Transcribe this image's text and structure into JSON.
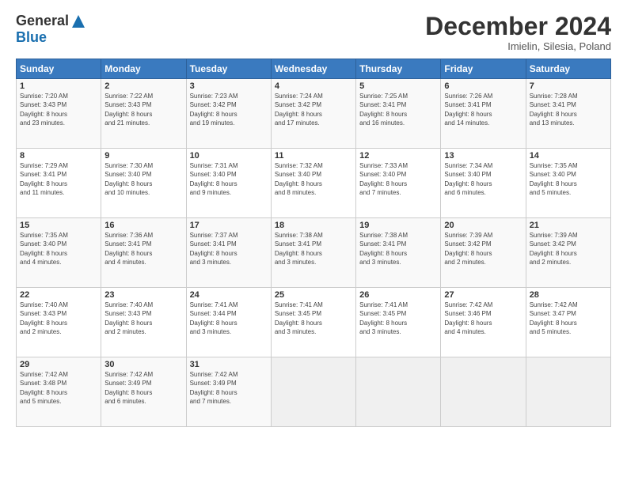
{
  "header": {
    "logo_general": "General",
    "logo_blue": "Blue",
    "month_title": "December 2024",
    "location": "Imielin, Silesia, Poland"
  },
  "calendar": {
    "days_of_week": [
      "Sunday",
      "Monday",
      "Tuesday",
      "Wednesday",
      "Thursday",
      "Friday",
      "Saturday"
    ],
    "weeks": [
      [
        {
          "day": "1",
          "info": "Sunrise: 7:20 AM\nSunset: 3:43 PM\nDaylight: 8 hours\nand 23 minutes."
        },
        {
          "day": "2",
          "info": "Sunrise: 7:22 AM\nSunset: 3:43 PM\nDaylight: 8 hours\nand 21 minutes."
        },
        {
          "day": "3",
          "info": "Sunrise: 7:23 AM\nSunset: 3:42 PM\nDaylight: 8 hours\nand 19 minutes."
        },
        {
          "day": "4",
          "info": "Sunrise: 7:24 AM\nSunset: 3:42 PM\nDaylight: 8 hours\nand 17 minutes."
        },
        {
          "day": "5",
          "info": "Sunrise: 7:25 AM\nSunset: 3:41 PM\nDaylight: 8 hours\nand 16 minutes."
        },
        {
          "day": "6",
          "info": "Sunrise: 7:26 AM\nSunset: 3:41 PM\nDaylight: 8 hours\nand 14 minutes."
        },
        {
          "day": "7",
          "info": "Sunrise: 7:28 AM\nSunset: 3:41 PM\nDaylight: 8 hours\nand 13 minutes."
        }
      ],
      [
        {
          "day": "8",
          "info": "Sunrise: 7:29 AM\nSunset: 3:41 PM\nDaylight: 8 hours\nand 11 minutes."
        },
        {
          "day": "9",
          "info": "Sunrise: 7:30 AM\nSunset: 3:40 PM\nDaylight: 8 hours\nand 10 minutes."
        },
        {
          "day": "10",
          "info": "Sunrise: 7:31 AM\nSunset: 3:40 PM\nDaylight: 8 hours\nand 9 minutes."
        },
        {
          "day": "11",
          "info": "Sunrise: 7:32 AM\nSunset: 3:40 PM\nDaylight: 8 hours\nand 8 minutes."
        },
        {
          "day": "12",
          "info": "Sunrise: 7:33 AM\nSunset: 3:40 PM\nDaylight: 8 hours\nand 7 minutes."
        },
        {
          "day": "13",
          "info": "Sunrise: 7:34 AM\nSunset: 3:40 PM\nDaylight: 8 hours\nand 6 minutes."
        },
        {
          "day": "14",
          "info": "Sunrise: 7:35 AM\nSunset: 3:40 PM\nDaylight: 8 hours\nand 5 minutes."
        }
      ],
      [
        {
          "day": "15",
          "info": "Sunrise: 7:35 AM\nSunset: 3:40 PM\nDaylight: 8 hours\nand 4 minutes."
        },
        {
          "day": "16",
          "info": "Sunrise: 7:36 AM\nSunset: 3:41 PM\nDaylight: 8 hours\nand 4 minutes."
        },
        {
          "day": "17",
          "info": "Sunrise: 7:37 AM\nSunset: 3:41 PM\nDaylight: 8 hours\nand 3 minutes."
        },
        {
          "day": "18",
          "info": "Sunrise: 7:38 AM\nSunset: 3:41 PM\nDaylight: 8 hours\nand 3 minutes."
        },
        {
          "day": "19",
          "info": "Sunrise: 7:38 AM\nSunset: 3:41 PM\nDaylight: 8 hours\nand 3 minutes."
        },
        {
          "day": "20",
          "info": "Sunrise: 7:39 AM\nSunset: 3:42 PM\nDaylight: 8 hours\nand 2 minutes."
        },
        {
          "day": "21",
          "info": "Sunrise: 7:39 AM\nSunset: 3:42 PM\nDaylight: 8 hours\nand 2 minutes."
        }
      ],
      [
        {
          "day": "22",
          "info": "Sunrise: 7:40 AM\nSunset: 3:43 PM\nDaylight: 8 hours\nand 2 minutes."
        },
        {
          "day": "23",
          "info": "Sunrise: 7:40 AM\nSunset: 3:43 PM\nDaylight: 8 hours\nand 2 minutes."
        },
        {
          "day": "24",
          "info": "Sunrise: 7:41 AM\nSunset: 3:44 PM\nDaylight: 8 hours\nand 3 minutes."
        },
        {
          "day": "25",
          "info": "Sunrise: 7:41 AM\nSunset: 3:45 PM\nDaylight: 8 hours\nand 3 minutes."
        },
        {
          "day": "26",
          "info": "Sunrise: 7:41 AM\nSunset: 3:45 PM\nDaylight: 8 hours\nand 3 minutes."
        },
        {
          "day": "27",
          "info": "Sunrise: 7:42 AM\nSunset: 3:46 PM\nDaylight: 8 hours\nand 4 minutes."
        },
        {
          "day": "28",
          "info": "Sunrise: 7:42 AM\nSunset: 3:47 PM\nDaylight: 8 hours\nand 5 minutes."
        }
      ],
      [
        {
          "day": "29",
          "info": "Sunrise: 7:42 AM\nSunset: 3:48 PM\nDaylight: 8 hours\nand 5 minutes."
        },
        {
          "day": "30",
          "info": "Sunrise: 7:42 AM\nSunset: 3:49 PM\nDaylight: 8 hours\nand 6 minutes."
        },
        {
          "day": "31",
          "info": "Sunrise: 7:42 AM\nSunset: 3:49 PM\nDaylight: 8 hours\nand 7 minutes."
        },
        {
          "day": "",
          "info": ""
        },
        {
          "day": "",
          "info": ""
        },
        {
          "day": "",
          "info": ""
        },
        {
          "day": "",
          "info": ""
        }
      ]
    ]
  }
}
